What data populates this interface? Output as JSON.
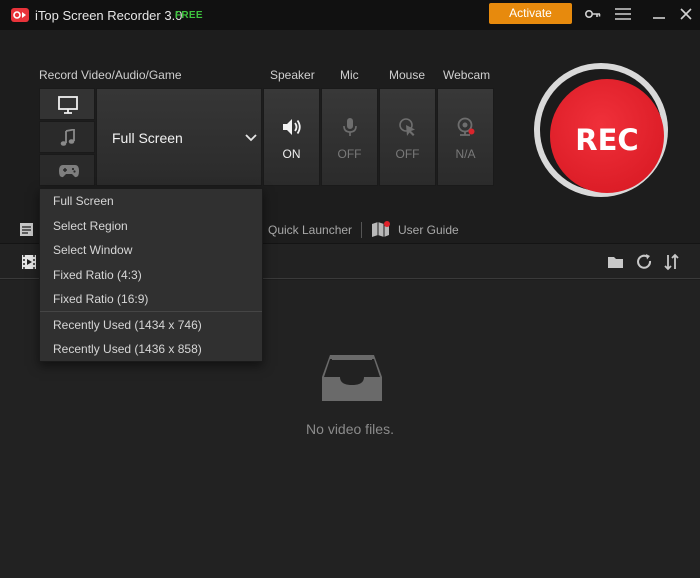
{
  "titlebar": {
    "title": "iTop Screen Recorder 3.0",
    "badge": "FREE",
    "activate_label": "Activate"
  },
  "record": {
    "section_label": "Record Video/Audio/Game",
    "mode_label": "Full Screen"
  },
  "devices": {
    "speaker": {
      "label": "Speaker",
      "state": "ON"
    },
    "mic": {
      "label": "Mic",
      "state": "OFF"
    },
    "mouse": {
      "label": "Mouse",
      "state": "OFF"
    },
    "webcam": {
      "label": "Webcam",
      "state": "N/A"
    }
  },
  "rec_button": {
    "label": "REC"
  },
  "toolbar": {
    "quick_launcher": "Quick Launcher",
    "user_guide": "User Guide"
  },
  "dropdown": {
    "items": [
      "Full Screen",
      "Select Region",
      "Select Window",
      "Fixed Ratio (4:3)",
      "Fixed Ratio (16:9)",
      "Recently Used (1434 x 746)",
      "Recently Used (1436 x 858)"
    ]
  },
  "files": {
    "empty_message": "No video files."
  },
  "colors": {
    "accent": "#e78a0d",
    "rec_red": "#e0222b",
    "free_green": "#3ec43e"
  }
}
